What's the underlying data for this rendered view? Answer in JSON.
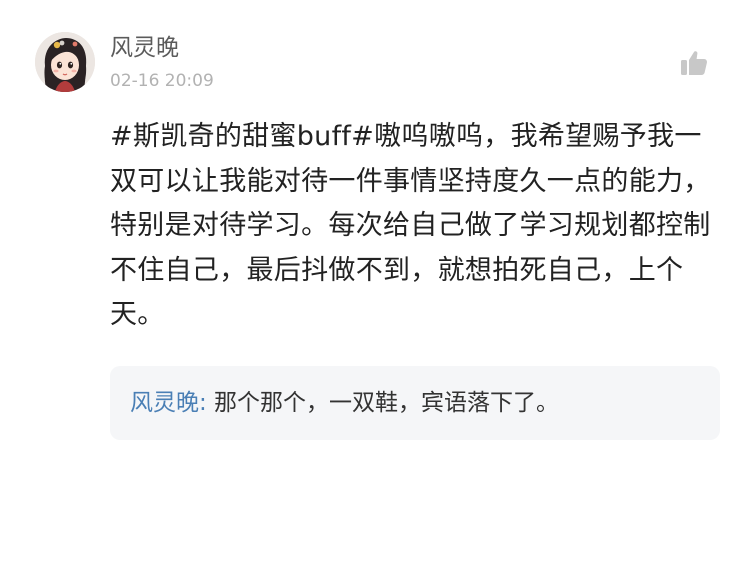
{
  "comment": {
    "author": "风灵晚",
    "timestamp": "02-16 20:09",
    "avatar_icon": "avatar-girl-icon",
    "like_icon": "thumbs-up-icon",
    "text": "#斯凯奇的甜蜜buff#嗷呜嗷呜，我希望赐予我一双可以让我能对待一件事情坚持度久一点的能力，特别是对待学习。每次给自己做了学习规划都控制不住自己，最后抖做不到，就想拍死自己，上个天。"
  },
  "reply": {
    "author": "风灵晚",
    "separator": ":",
    "text": " 那个那个，一双鞋，宾语落下了。"
  },
  "colors": {
    "author_name": "#5b5b5b",
    "timestamp": "#b2b2b2",
    "body_text": "#222222",
    "reply_author": "#4a7fb5",
    "reply_background": "#f5f6f8",
    "like_icon": "#c8c8c8"
  }
}
